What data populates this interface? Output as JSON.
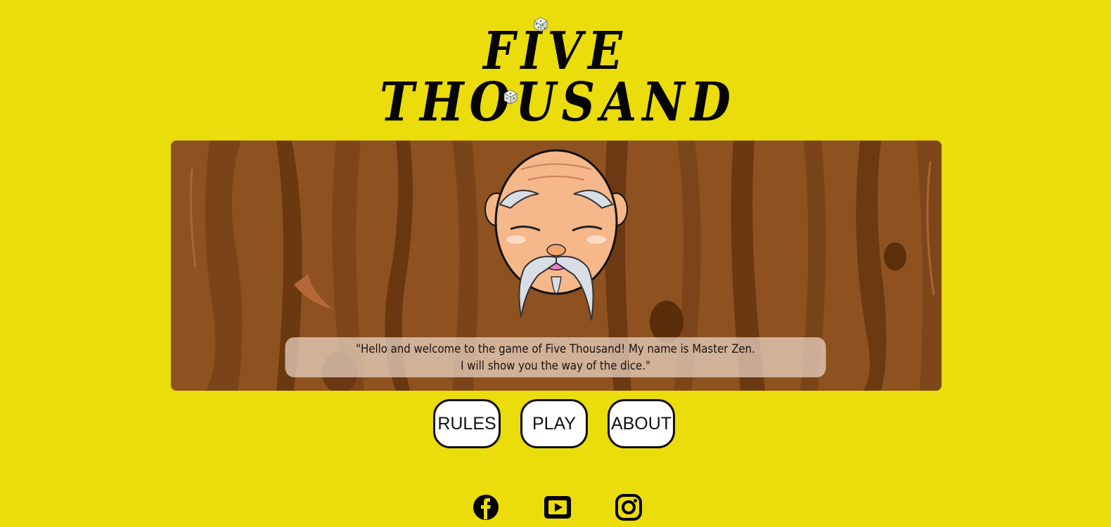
{
  "header": {
    "title_line1": "FIVE",
    "title_line2": "THOUSAND"
  },
  "speech": {
    "line1": "\"Hello and welcome to the game of Five Thousand! My name is Master Zen.",
    "line2": "I will show you the way of the dice.\""
  },
  "nav": {
    "rules_label": "RULES",
    "play_label": "PLAY",
    "about_label": "ABOUT"
  },
  "social": {
    "icons": [
      "facebook-icon",
      "youtube-icon",
      "instagram-icon"
    ]
  },
  "colors": {
    "background": "#ebdc0b",
    "wood": "#8b4f1f",
    "button_bg": "#ffffff",
    "button_border": "#111111"
  }
}
